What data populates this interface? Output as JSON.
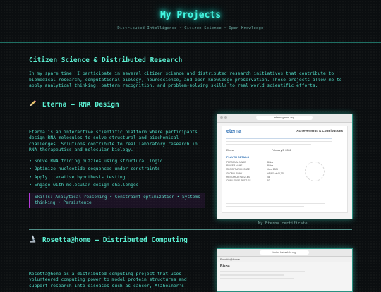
{
  "header": {
    "title": "My Projects",
    "tagline": "Distributed Intelligence • Citizen Science • Open Knowledge"
  },
  "section": {
    "title": "Citizen Science & Distributed Research",
    "intro": "In my spare time, I participate in several citizen science and distributed research initiatives that contribute to biomedical research, computational biology, neuroscience, and open knowledge preservation. These projects allow me to apply analytical thinking, pattern recognition, and problem-solving skills to real world scientific efforts."
  },
  "eterna": {
    "title": "Eterna — RNA Design",
    "description": "Eterna is an interactive scientific platform where participants design RNA molecules to solve structural and biochemical challenges. Solutions contribute to real laboratory research in RNA therapeutics and molecular biology.",
    "bullets": [
      "Solve RNA folding puzzles using structural logic",
      "Optimize nucleotide sequences under constraints",
      "Apply iterative hypothesis testing",
      "Engage with molecular design challenges"
    ],
    "skills": "Skills: Analytical reasoning • Constraint optimization • Systems thinking • Persistence",
    "caption": "My Eterna certificate.",
    "certificate": {
      "url": "eternagame.org",
      "logo": "eterna",
      "heading": "Achievements & Contributions",
      "name_line": "Eterna",
      "date": "February 3, 2026",
      "details_title": "PLAYER DETAILS",
      "rows": [
        [
          "PERSONAL NAME",
          "Bisha"
        ],
        [
          "PLAYER NAME",
          "Bisha"
        ],
        [
          "REGISTRATION DATE",
          "June 2025"
        ],
        [
          "GLOBAL RANK",
          "#5,901 of 48,720"
        ],
        [
          "RESEARCH PUZZLES",
          "46"
        ],
        [
          "CHALLENGE PUZZLES",
          "52"
        ]
      ]
    }
  },
  "rosetta": {
    "title": "Rosetta@home — Distributed Computing",
    "description": "Rosetta@home is a distributed computing project that uses volunteered computing power to model protein structures and support research into diseases such as cancer, Alzheimer's",
    "screenshot": {
      "url": "boinc.bakerlab.org",
      "site": "Rosetta@home",
      "name": "Bisha"
    }
  }
}
